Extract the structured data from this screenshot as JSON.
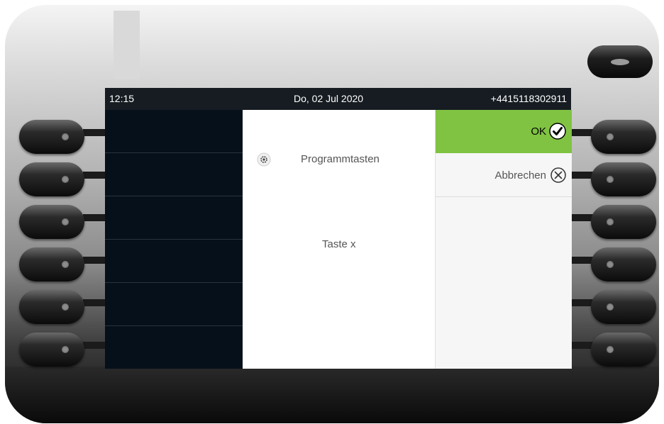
{
  "status_bar": {
    "time": "12:15",
    "date": "Do, 02 Jul 2020",
    "phone_number": "+4415118302911"
  },
  "menu": {
    "item_label": "Programmtasten",
    "item_icon": "gear-icon",
    "value": "Taste x"
  },
  "actions": {
    "ok_label": "OK",
    "ok_icon": "check-circle-icon",
    "cancel_label": "Abbrechen",
    "cancel_icon": "x-circle-icon"
  },
  "colors": {
    "accent_green": "#80c342",
    "screen_dark": "#050c14",
    "status_bar": "#161c22"
  }
}
